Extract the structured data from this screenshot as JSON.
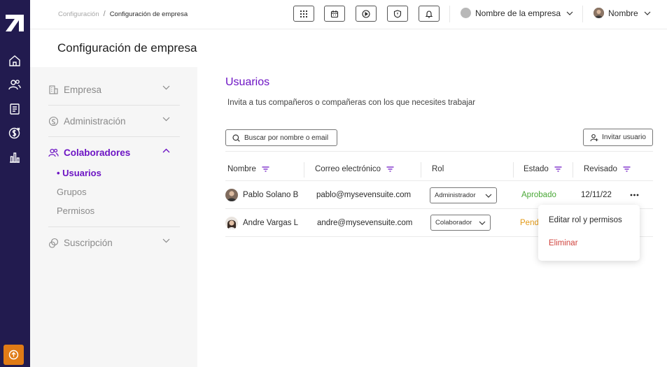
{
  "breadcrumb": {
    "parent": "Configuración",
    "separator": "/",
    "current": "Configuración de empresa"
  },
  "header": {
    "company_name": "Nombre de la empresa",
    "user_name": "Nombre"
  },
  "page_title": "Configuración de empresa",
  "sidebar": {
    "items": [
      {
        "label": "Empresa",
        "icon": "building-icon",
        "expanded": false
      },
      {
        "label": "Administración",
        "icon": "admin-icon",
        "expanded": false
      },
      {
        "label": "Colaboradores",
        "icon": "users-icon",
        "expanded": true,
        "children": [
          {
            "label": "• Usuarios",
            "active": true
          },
          {
            "label": "Grupos"
          },
          {
            "label": "Permisos"
          }
        ]
      },
      {
        "label": "Suscripción",
        "icon": "subscription-icon",
        "expanded": false
      }
    ]
  },
  "main": {
    "title": "Usuarios",
    "description": "Invita a tus compañeros o compañeras con los que necesites trabajar",
    "search_placeholder": "Buscar por nombre o email",
    "invite_label": "Invitar usuario",
    "columns": [
      "Nombre",
      "Correo electrónico",
      "Rol",
      "Estado",
      "Revisado"
    ],
    "rows": [
      {
        "name": "Pablo Solano B",
        "email": "pablo@mysevensuite.com",
        "role": "Administrador",
        "status": "Aprobado",
        "reviewed": "12/11/22"
      },
      {
        "name": "Andre Vargas L",
        "email": "andre@mysevensuite.com",
        "role": "Colaborador",
        "status": "Pendiente",
        "reviewed": ""
      }
    ]
  },
  "context_menu": {
    "edit_label": "Editar rol y permisos",
    "delete_label": "Eliminar"
  },
  "colors": {
    "rail": "#221b4f",
    "accent": "#6d14c4",
    "approved": "#4aa837",
    "pending": "#e39a17",
    "danger": "#d0443e",
    "upgrade": "#e07b16"
  }
}
